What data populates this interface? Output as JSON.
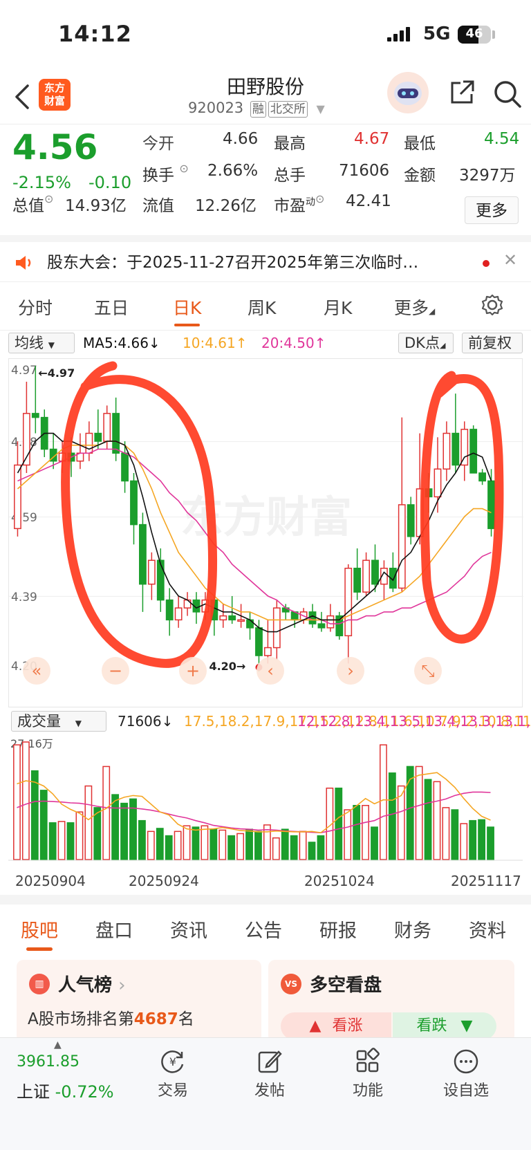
{
  "status_bar": {
    "time": "14:12",
    "network": "5G",
    "battery": "46"
  },
  "header": {
    "logo_text_1": "东方",
    "logo_text_2": "财富",
    "title": "田野股份",
    "code": "920023",
    "tag_margin": "融",
    "tag_exchange": "北交所"
  },
  "quote": {
    "price": "4.56",
    "change_pct": "-2.15%",
    "change": "-0.10",
    "items": [
      {
        "label": "今开",
        "value": "4.66"
      },
      {
        "label": "最高",
        "value": "4.67"
      },
      {
        "label": "最低",
        "value": "4.54"
      },
      {
        "label": "换手",
        "value": "2.66%"
      },
      {
        "label": "总手",
        "value": "71606"
      },
      {
        "label": "金额",
        "value": "3297万"
      },
      {
        "label": "总值",
        "value": "14.93亿"
      },
      {
        "label": "流值",
        "value": "12.26亿"
      },
      {
        "label": "市盈",
        "sup": "动",
        "value": "42.41"
      }
    ],
    "more_label": "更多"
  },
  "notice": {
    "text": "股东大会：于2025-11-27召开2025年第三次临时…"
  },
  "chart_tabs": [
    "分时",
    "五日",
    "日K",
    "周K",
    "月K",
    "更多"
  ],
  "active_chart_tab": "日K",
  "ma_row": {
    "select": "均线",
    "ma5": "MA5:4.66↓",
    "ma10": "10:4.61↑",
    "ma20": "20:4.50↑",
    "dk": "DK点",
    "fq": "前复权"
  },
  "colors": {
    "up": "#e03232",
    "down": "#1b9e2c",
    "accent": "#e8591a",
    "ma5": "#111111",
    "ma10": "#f5a623",
    "ma20": "#e0359a",
    "annotation": "#ff3b1f"
  },
  "chart_data": {
    "type": "candlestick",
    "y_ticks": [
      "4.97",
      "4.78",
      "4.59",
      "4.39",
      "4.20"
    ],
    "ylim": [
      4.2,
      4.97
    ],
    "max_marker": "←4.97",
    "min_marker": "4.20→",
    "candles": [
      [
        4.56,
        4.72,
        4.78,
        4.54
      ],
      [
        4.72,
        4.85,
        4.93,
        4.7
      ],
      [
        4.85,
        4.84,
        4.97,
        4.8
      ],
      [
        4.84,
        4.76,
        4.86,
        4.74
      ],
      [
        4.76,
        4.73,
        4.8,
        4.71
      ],
      [
        4.73,
        4.75,
        4.78,
        4.7
      ],
      [
        4.75,
        4.73,
        4.79,
        4.69
      ],
      [
        4.73,
        4.75,
        4.8,
        4.71
      ],
      [
        4.75,
        4.8,
        4.83,
        4.73
      ],
      [
        4.8,
        4.78,
        4.86,
        4.76
      ],
      [
        4.78,
        4.85,
        4.87,
        4.76
      ],
      [
        4.85,
        4.75,
        4.89,
        4.73
      ],
      [
        4.75,
        4.68,
        4.78,
        4.65
      ],
      [
        4.68,
        4.57,
        4.7,
        4.52
      ],
      [
        4.57,
        4.42,
        4.6,
        4.35
      ],
      [
        4.42,
        4.48,
        4.5,
        4.38
      ],
      [
        4.48,
        4.38,
        4.51,
        4.35
      ],
      [
        4.38,
        4.33,
        4.41,
        4.29
      ],
      [
        4.33,
        4.36,
        4.39,
        4.31
      ],
      [
        4.36,
        4.38,
        4.4,
        4.34
      ],
      [
        4.38,
        4.35,
        4.4,
        4.32
      ],
      [
        4.35,
        4.38,
        4.4,
        4.33
      ],
      [
        4.38,
        4.33,
        4.39,
        4.29
      ],
      [
        4.33,
        4.34,
        4.37,
        4.31
      ],
      [
        4.34,
        4.33,
        4.39,
        4.32
      ],
      [
        4.33,
        4.33,
        4.37,
        4.31
      ],
      [
        4.33,
        4.31,
        4.35,
        4.28
      ],
      [
        4.31,
        4.24,
        4.33,
        4.2
      ],
      [
        4.24,
        4.26,
        4.33,
        4.22
      ],
      [
        4.26,
        4.36,
        4.38,
        4.23
      ],
      [
        4.36,
        4.35,
        4.37,
        4.33
      ],
      [
        4.35,
        4.33,
        4.35,
        4.31
      ],
      [
        4.33,
        4.35,
        4.36,
        4.32
      ],
      [
        4.35,
        4.32,
        4.37,
        4.31
      ],
      [
        4.32,
        4.31,
        4.35,
        4.3
      ],
      [
        4.31,
        4.34,
        4.37,
        4.3
      ],
      [
        4.34,
        4.29,
        4.35,
        4.28
      ],
      [
        4.29,
        4.46,
        4.47,
        4.22
      ],
      [
        4.46,
        4.4,
        4.51,
        4.38
      ],
      [
        4.4,
        4.48,
        4.5,
        4.39
      ],
      [
        4.48,
        4.42,
        4.52,
        4.4
      ],
      [
        4.42,
        4.46,
        4.48,
        4.38
      ],
      [
        4.46,
        4.41,
        4.5,
        4.4
      ],
      [
        4.41,
        4.62,
        4.84,
        4.4
      ],
      [
        4.62,
        4.54,
        4.64,
        4.52
      ],
      [
        4.54,
        4.66,
        4.8,
        4.52
      ],
      [
        4.66,
        4.64,
        4.7,
        4.6
      ],
      [
        4.64,
        4.71,
        4.79,
        4.6
      ],
      [
        4.71,
        4.8,
        4.83,
        4.68
      ],
      [
        4.8,
        4.72,
        4.9,
        4.7
      ],
      [
        4.72,
        4.81,
        4.83,
        4.68
      ],
      [
        4.81,
        4.7,
        4.82,
        4.7
      ],
      [
        4.7,
        4.68,
        4.71,
        4.67
      ],
      [
        4.68,
        4.56,
        4.71,
        4.54
      ]
    ],
    "ma5": [
      4.7,
      4.74,
      4.78,
      4.8,
      4.8,
      4.78,
      4.78,
      4.77,
      4.76,
      4.77,
      4.78,
      4.78,
      4.77,
      4.72,
      4.64,
      4.55,
      4.47,
      4.42,
      4.39,
      4.38,
      4.36,
      4.37,
      4.36,
      4.35,
      4.35,
      4.34,
      4.33,
      4.31,
      4.3,
      4.3,
      4.31,
      4.32,
      4.33,
      4.34,
      4.33,
      4.33,
      4.33,
      4.35,
      4.37,
      4.39,
      4.41,
      4.45,
      4.43,
      4.48,
      4.5,
      4.54,
      4.58,
      4.63,
      4.67,
      4.7,
      4.74,
      4.75,
      4.74,
      4.68
    ],
    "ma10": [
      4.66,
      4.68,
      4.7,
      4.72,
      4.74,
      4.76,
      4.77,
      4.77,
      4.77,
      4.77,
      4.78,
      4.78,
      4.77,
      4.75,
      4.71,
      4.66,
      4.6,
      4.55,
      4.5,
      4.47,
      4.44,
      4.41,
      4.39,
      4.37,
      4.36,
      4.35,
      4.35,
      4.34,
      4.33,
      4.33,
      4.33,
      4.33,
      4.33,
      4.33,
      4.33,
      4.33,
      4.33,
      4.34,
      4.35,
      4.36,
      4.37,
      4.38,
      4.39,
      4.4,
      4.42,
      4.44,
      4.47,
      4.5,
      4.53,
      4.56,
      4.59,
      4.61,
      4.61,
      4.6
    ],
    "ma20": [
      4.68,
      4.69,
      4.7,
      4.71,
      4.72,
      4.73,
      4.74,
      4.75,
      4.75,
      4.76,
      4.76,
      4.76,
      4.75,
      4.74,
      4.72,
      4.7,
      4.68,
      4.65,
      4.63,
      4.6,
      4.58,
      4.55,
      4.52,
      4.5,
      4.47,
      4.45,
      4.43,
      4.41,
      4.39,
      4.38,
      4.36,
      4.35,
      4.34,
      4.33,
      4.33,
      4.32,
      4.32,
      4.33,
      4.33,
      4.34,
      4.34,
      4.35,
      4.35,
      4.36,
      4.36,
      4.37,
      4.38,
      4.39,
      4.4,
      4.42,
      4.44,
      4.47,
      4.49,
      4.5
    ]
  },
  "volume": {
    "select": "成交量",
    "value": "71606↓",
    "ma1": [
      17.5,
      18.2,
      17.9,
      17.0,
      15.2,
      12.8,
      11.6,
      10.7,
      9.2,
      10.8,
      11.8,
      13.6,
      14.4,
      14.8,
      14.6,
      12.8,
      11.0,
      10.3,
      8.2,
      7.1,
      6.8,
      7.0,
      7.1,
      7.4,
      7.1,
      6.7,
      6.6,
      6.4,
      6.4,
      6.6,
      6.5,
      6.4,
      6.4,
      6.5,
      6.2,
      7.8,
      9.7,
      10.9,
      12.4,
      14.1,
      12.9,
      13.8,
      13.7,
      14.8,
      18.6,
      19.5,
      19.8,
      20.1,
      18.6,
      16.7,
      14.1,
      11.8,
      10.0,
      9.1
    ],
    "ma2": [
      12.0,
      12.8,
      13.4,
      13.5,
      13.4,
      13.3,
      13.1,
      13.0,
      12.7,
      12.3,
      12.0,
      11.9,
      11.9,
      11.9,
      11.7,
      11.4,
      11.0,
      10.5,
      10.0,
      9.6,
      9.0,
      8.5,
      7.9,
      7.6,
      7.3,
      7.1,
      7.0,
      6.8,
      6.9,
      6.8,
      6.6,
      6.5,
      6.4,
      6.3,
      6.2,
      6.6,
      7.1,
      7.5,
      8.1,
      8.6,
      9.0,
      10.0,
      10.5,
      11.1,
      11.9,
      12.5,
      13.1,
      13.5,
      14.0,
      14.8,
      15.3,
      15.6,
      15.6,
      15.5
    ],
    "max_label": "27.16万",
    "unit": "万",
    "bars": [
      26.5,
      27.16,
      20.5,
      16,
      8.5,
      8.8,
      8.5,
      11,
      17,
      12,
      21.5,
      15,
      13,
      14,
      9,
      6.5,
      7.2,
      5.5,
      6.5,
      7.8,
      7.5,
      7.8,
      7,
      6.8,
      5.5,
      6,
      7,
      6.5,
      8,
      5,
      7,
      5.5,
      6.5,
      4,
      5.5,
      16.5,
      16.5,
      11.5,
      12.5,
      12.5,
      7.5,
      26.5,
      20,
      17,
      21.5,
      21.5,
      18.5,
      18,
      12,
      11.5,
      8.3,
      9,
      9.2,
      7.5
    ]
  },
  "dates": [
    "20250904",
    "20250924",
    "20251024",
    "20251117"
  ],
  "bottom_tabs": [
    "股吧",
    "盘口",
    "资讯",
    "公告",
    "研报",
    "财务",
    "资料"
  ],
  "active_bottom_tab": "股吧",
  "cards": {
    "popularity": {
      "title": "人气榜",
      "rank_prefix": "A股市场排名第",
      "rank": "4687",
      "rank_suffix": "名"
    },
    "sentiment": {
      "title": "多空看盘",
      "up": "看涨",
      "down": "看跌"
    }
  },
  "bottom_bar": {
    "index_value": "3961.85",
    "index_name": "上证",
    "index_change": "-0.72%",
    "items": [
      "交易",
      "发帖",
      "功能",
      "设自选"
    ]
  },
  "watermark": "东方财富"
}
